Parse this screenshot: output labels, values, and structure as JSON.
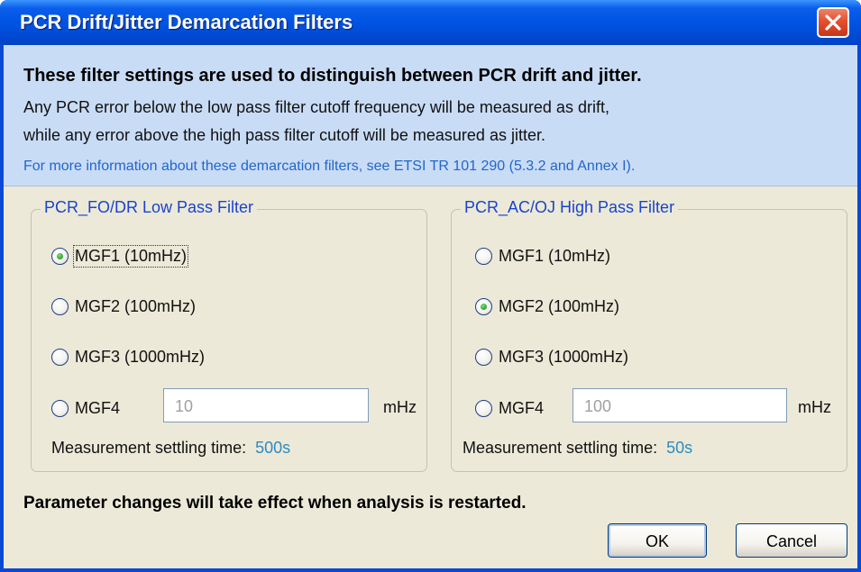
{
  "window": {
    "title": "PCR Drift/Jitter Demarcation Filters"
  },
  "info": {
    "heading": "These filter settings are used to distinguish between PCR drift and jitter.",
    "line1": "Any PCR error below the low pass filter cutoff frequency will be measured as drift,",
    "line2": "while any error above the high pass filter cutoff will be measured as jitter.",
    "link": "For more information about these demarcation filters, see ETSI TR 101 290 (5.3.2 and Annex I)."
  },
  "low_pass": {
    "title": "PCR_FO/DR Low Pass Filter",
    "options": [
      {
        "label": "MGF1 (10mHz)",
        "selected": true
      },
      {
        "label": "MGF2 (100mHz)",
        "selected": false
      },
      {
        "label": "MGF3 (1000mHz)",
        "selected": false
      },
      {
        "label": "MGF4",
        "selected": false
      }
    ],
    "custom_value": "10",
    "unit": "mHz",
    "settling_label": "Measurement settling time:",
    "settling_value": "500s"
  },
  "high_pass": {
    "title": "PCR_AC/OJ High Pass Filter",
    "options": [
      {
        "label": "MGF1 (10mHz)",
        "selected": false
      },
      {
        "label": "MGF2 (100mHz)",
        "selected": true
      },
      {
        "label": "MGF3 (1000mHz)",
        "selected": false
      },
      {
        "label": "MGF4",
        "selected": false
      }
    ],
    "custom_value": "100",
    "unit": "mHz",
    "settling_label": "Measurement settling time:",
    "settling_value": "50s"
  },
  "footer": {
    "note": "Parameter changes will take effect when analysis is restarted.",
    "ok_label": "OK",
    "cancel_label": "Cancel"
  },
  "colors": {
    "titlebar": "#0054E3",
    "info_panel": "#C9DCF6",
    "dialog_background": "#ECE9D8",
    "group_title": "#1A44CC",
    "link": "#2266CC",
    "settling_value": "#2E8BC0",
    "close_button": "#E3502E"
  },
  "icons": {
    "close": "close-icon"
  }
}
